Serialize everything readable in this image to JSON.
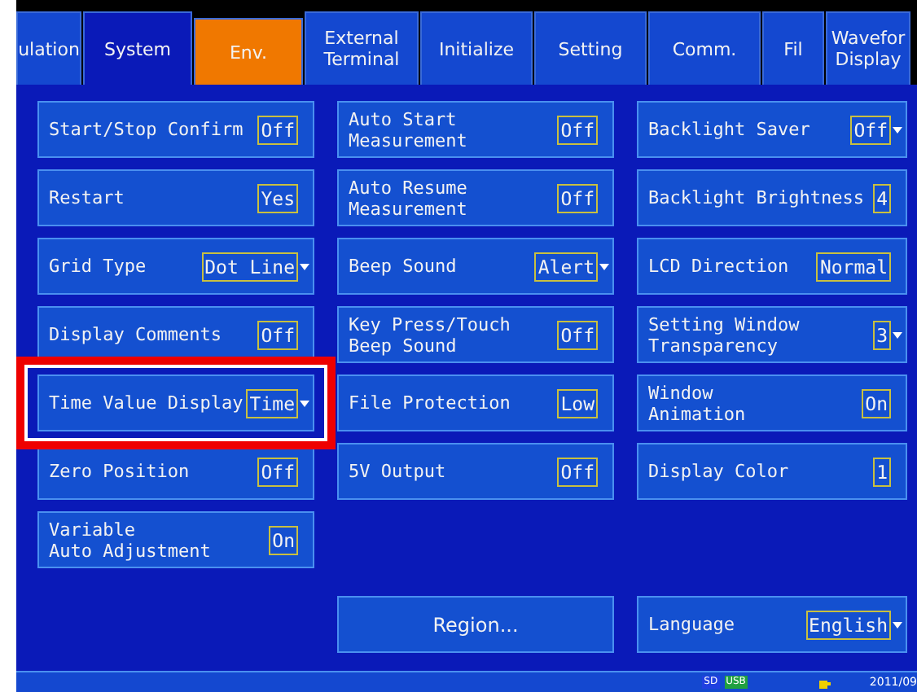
{
  "tabs": [
    {
      "label": "ulation",
      "selected": false,
      "kind": "normal"
    },
    {
      "label": "System",
      "selected": true,
      "kind": "normal"
    },
    {
      "label": "Env.",
      "selected": false,
      "kind": "accent"
    },
    {
      "label": "External\nTerminal",
      "selected": false,
      "kind": "normal"
    },
    {
      "label": "Initialize",
      "selected": false,
      "kind": "normal"
    },
    {
      "label": "Setting",
      "selected": false,
      "kind": "normal"
    },
    {
      "label": "Comm.",
      "selected": false,
      "kind": "normal"
    },
    {
      "label": "Fil",
      "selected": false,
      "kind": "normal"
    },
    {
      "label": "Wavefor\nDisplay",
      "selected": false,
      "kind": "normal"
    }
  ],
  "columns": [
    [
      {
        "label": "Start/Stop Confirm",
        "value": "Off",
        "dropdown": false,
        "highlighted": false
      },
      {
        "label": "Restart",
        "value": "Yes",
        "dropdown": false,
        "highlighted": false
      },
      {
        "label": "Grid Type",
        "value": "Dot Line",
        "dropdown": true,
        "highlighted": false
      },
      {
        "label": "Display Comments",
        "value": "Off",
        "dropdown": false,
        "highlighted": false
      },
      {
        "label": "Time Value Display",
        "value": "Time",
        "dropdown": true,
        "highlighted": true
      },
      {
        "label": "Zero Position",
        "value": "Off",
        "dropdown": false,
        "highlighted": false
      },
      {
        "label": "Variable\nAuto Adjustment",
        "value": "On",
        "dropdown": false,
        "highlighted": false
      }
    ],
    [
      {
        "label": "Auto Start\nMeasurement",
        "value": "Off",
        "dropdown": false,
        "highlighted": false
      },
      {
        "label": "Auto Resume\nMeasurement",
        "value": "Off",
        "dropdown": false,
        "highlighted": false
      },
      {
        "label": "Beep Sound",
        "value": "Alert",
        "dropdown": true,
        "highlighted": false
      },
      {
        "label": "Key Press/Touch\nBeep Sound",
        "value": "Off",
        "dropdown": false,
        "highlighted": false
      },
      {
        "label": "File Protection",
        "value": "Low",
        "dropdown": false,
        "highlighted": false
      },
      {
        "label": "5V Output",
        "value": "Off",
        "dropdown": false,
        "highlighted": false
      }
    ],
    [
      {
        "label": "Backlight Saver",
        "value": "Off",
        "dropdown": true,
        "highlighted": false
      },
      {
        "label": "Backlight Brightness",
        "value": "4",
        "dropdown": false,
        "highlighted": false
      },
      {
        "label": "LCD Direction",
        "value": "Normal",
        "dropdown": false,
        "highlighted": false
      },
      {
        "label": "Setting Window\nTransparency",
        "value": "3",
        "dropdown": true,
        "highlighted": false
      },
      {
        "label": "Window\nAnimation",
        "value": "On",
        "dropdown": false,
        "highlighted": false
      },
      {
        "label": "Display Color",
        "value": "1",
        "dropdown": false,
        "highlighted": false
      }
    ]
  ],
  "region_button": "Region...",
  "language": {
    "label": "Language",
    "value": "English",
    "dropdown": true
  },
  "status_bar": {
    "sd": "SD",
    "usb": "USB",
    "date": "2011/09"
  }
}
